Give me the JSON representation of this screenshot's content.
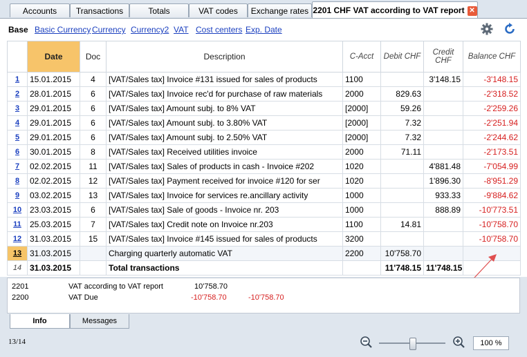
{
  "tabs": [
    {
      "label": "Accounts"
    },
    {
      "label": "Transactions"
    },
    {
      "label": "Totals"
    },
    {
      "label": "VAT codes"
    },
    {
      "label": "Exchange rates"
    },
    {
      "label": "2201 CHF VAT according to VAT report"
    }
  ],
  "views": {
    "base": "Base",
    "basic_currency": "Basic Currency",
    "currency": "Currency",
    "currency2": "Currency2",
    "vat": "VAT",
    "cost_centers": "Cost centers",
    "exp_date": "Exp. Date"
  },
  "columns": {
    "date": "Date",
    "doc": "Doc",
    "description": "Description",
    "c_acct": "C-Acct",
    "debit": "Debit CHF",
    "credit": "Credit CHF",
    "balance": "Balance CHF"
  },
  "rows": [
    {
      "n": "1",
      "date": "15.01.2015",
      "doc": "4",
      "desc": "[VAT/Sales tax] Invoice #131 issued for sales of products",
      "acct": "1100",
      "debit": "",
      "credit": "3'148.15",
      "balance": "-3'148.15"
    },
    {
      "n": "2",
      "date": "28.01.2015",
      "doc": "6",
      "desc": "[VAT/Sales tax] Invoice rec'd for purchase of raw materials",
      "acct": "2000",
      "debit": "829.63",
      "credit": "",
      "balance": "-2'318.52"
    },
    {
      "n": "3",
      "date": "29.01.2015",
      "doc": "6",
      "desc": "[VAT/Sales tax] Amount subj. to 8% VAT",
      "acct": "[2000]",
      "debit": "59.26",
      "credit": "",
      "balance": "-2'259.26"
    },
    {
      "n": "4",
      "date": "29.01.2015",
      "doc": "6",
      "desc": "[VAT/Sales tax] Amount subj. to 3.80% VAT",
      "acct": "[2000]",
      "debit": "7.32",
      "credit": "",
      "balance": "-2'251.94"
    },
    {
      "n": "5",
      "date": "29.01.2015",
      "doc": "6",
      "desc": "[VAT/Sales tax] Amount subj. to 2.50% VAT",
      "acct": "[2000]",
      "debit": "7.32",
      "credit": "",
      "balance": "-2'244.62"
    },
    {
      "n": "6",
      "date": "30.01.2015",
      "doc": "8",
      "desc": "[VAT/Sales tax] Received utilities invoice",
      "acct": "2000",
      "debit": "71.11",
      "credit": "",
      "balance": "-2'173.51"
    },
    {
      "n": "7",
      "date": "02.02.2015",
      "doc": "11",
      "desc": "[VAT/Sales tax] Sales of products in cash - Invoice #202",
      "acct": "1020",
      "debit": "",
      "credit": "4'881.48",
      "balance": "-7'054.99"
    },
    {
      "n": "8",
      "date": "02.02.2015",
      "doc": "12",
      "desc": "[VAT/Sales tax] Payment received for invoice #120 for ser",
      "acct": "1020",
      "debit": "",
      "credit": "1'896.30",
      "balance": "-8'951.29"
    },
    {
      "n": "9",
      "date": "03.02.2015",
      "doc": "13",
      "desc": "[VAT/Sales tax] Invoice for services re.ancillary activity",
      "acct": "1000",
      "debit": "",
      "credit": "933.33",
      "balance": "-9'884.62"
    },
    {
      "n": "10",
      "date": "23.03.2015",
      "doc": "6",
      "desc": "[VAT/Sales tax] Sale of goods - Invoice nr. 203",
      "acct": "1000",
      "debit": "",
      "credit": "888.89",
      "balance": "-10'773.51"
    },
    {
      "n": "11",
      "date": "25.03.2015",
      "doc": "7",
      "desc": "[VAT/Sales tax] Credit note on Invoice nr.203",
      "acct": "1100",
      "debit": "14.81",
      "credit": "",
      "balance": "-10'758.70"
    },
    {
      "n": "12",
      "date": "31.03.2015",
      "doc": "15",
      "desc": "[VAT/Sales tax] Invoice #145 issued for sales of products",
      "acct": "3200",
      "debit": "",
      "credit": "",
      "balance": "-10'758.70"
    },
    {
      "n": "13",
      "date": "31.03.2015",
      "doc": "",
      "desc": "Charging quarterly automatic VAT",
      "acct": "2200",
      "debit": "10'758.70",
      "credit": "",
      "balance": ""
    }
  ],
  "total_row": {
    "n": "14",
    "date": "31.03.2015",
    "desc": "Total transactions",
    "debit": "11'748.15",
    "credit": "11'748.15"
  },
  "info": {
    "line1": {
      "acct": "2201",
      "name": "VAT according to VAT report",
      "v1": "10'758.70",
      "v2": ""
    },
    "line2": {
      "acct": "2200",
      "name": "VAT Due",
      "v1": "-10'758.70",
      "v2": "-10'758.70"
    }
  },
  "bottom_tabs": {
    "info": "Info",
    "messages": "Messages"
  },
  "status": {
    "position": "13/14",
    "zoom": "100 %"
  },
  "colors": {
    "negative": "#d61e1e",
    "link": "#1a3fbf",
    "selected_header": "#f7c46a",
    "arrow": "#e05050"
  }
}
